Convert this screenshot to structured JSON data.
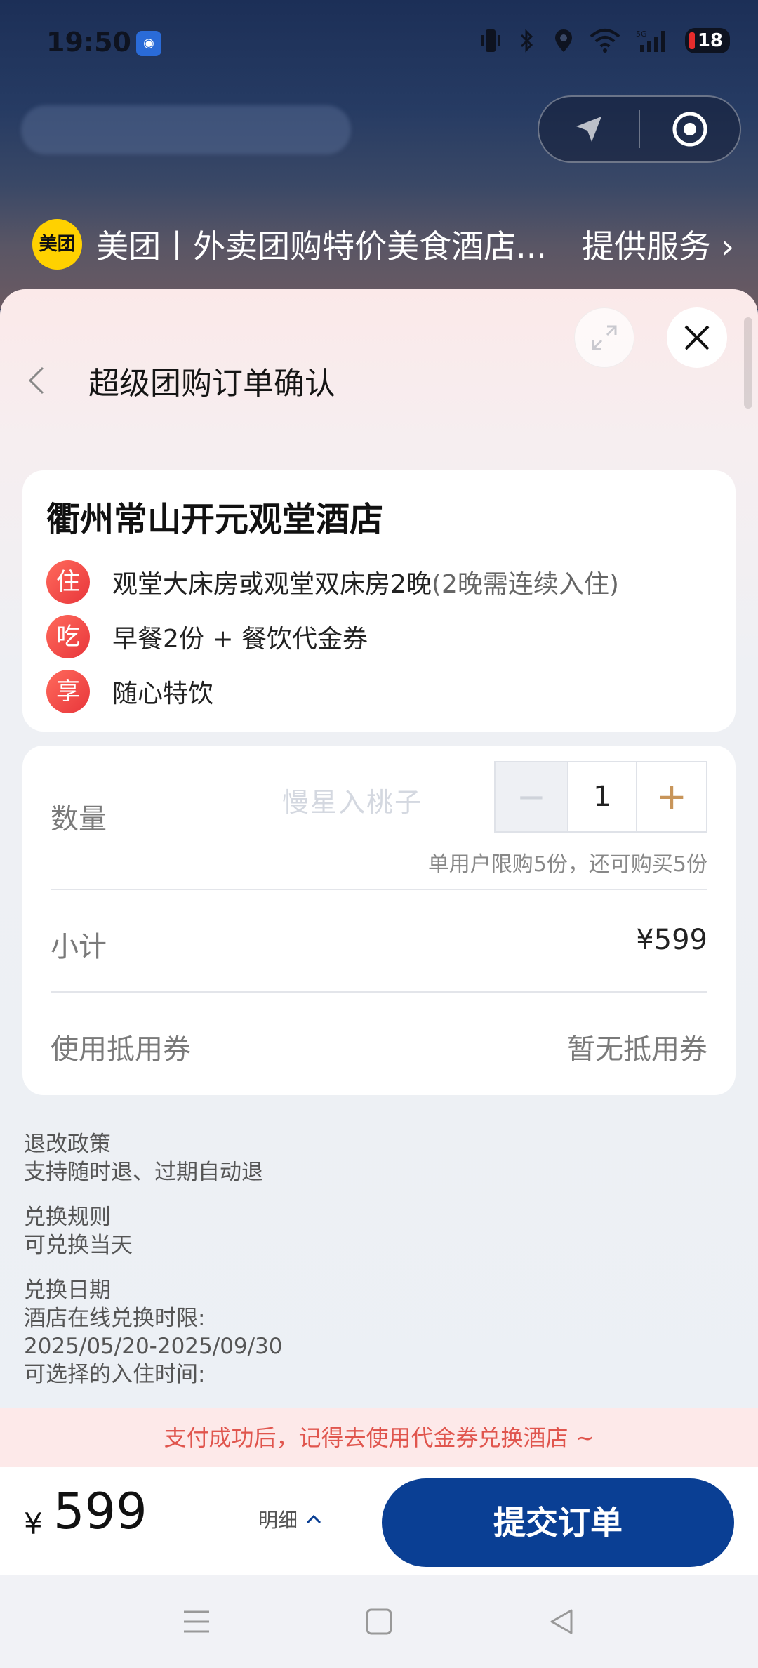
{
  "status_bar": {
    "time": "19:50",
    "battery": "18",
    "icons": [
      "vibrate-icon",
      "bluetooth-icon",
      "location-icon",
      "wifi-icon",
      "signal-5g-icon"
    ]
  },
  "service_bar": {
    "logo": "美团",
    "title": "美团丨外卖团购特价美食酒店...",
    "provider": "提供服务"
  },
  "sheet": {
    "page_title": "超级团购订单确认"
  },
  "product": {
    "hotel_name": "衢州常山开元观堂酒店",
    "features": [
      {
        "badge": "住",
        "text": "观堂大床房或观堂双床房2晚",
        "note": "(2晚需连续入住)"
      },
      {
        "badge": "吃",
        "text": "早餐2份 + 餐饮代金券",
        "note": ""
      },
      {
        "badge": "享",
        "text": "随心特饮",
        "note": ""
      }
    ]
  },
  "order": {
    "qty_label": "数量",
    "watermark": "慢星入桃子",
    "qty_minus": "−",
    "qty_value": "1",
    "qty_plus": "+",
    "limit_text": "单用户限购5份，还可购买5份",
    "subtotal_label": "小计",
    "subtotal_value": "¥599",
    "coupon_label": "使用抵用券",
    "coupon_value": "暂无抵用券"
  },
  "policy": {
    "refund_title": "退改政策",
    "refund_text": "支持随时退、过期自动退",
    "exchange_title": "兑换规则",
    "exchange_text": "可兑换当天",
    "date_title": "兑换日期",
    "date_line1": "酒店在线兑换时限:",
    "date_line2": "2025/05/20-2025/09/30",
    "date_line3": "可选择的入住时间:"
  },
  "pay_tip": "支付成功后，记得去使用代金券兑换酒店 ~",
  "bottom": {
    "currency": "¥",
    "price": "599",
    "detail_label": "明细",
    "submit_label": "提交订单"
  },
  "colors": {
    "submit_bg": "#0a3f94",
    "feature_badge": "#e8363b",
    "tip_text": "#e0554d",
    "plus_color": "#c8955a"
  }
}
